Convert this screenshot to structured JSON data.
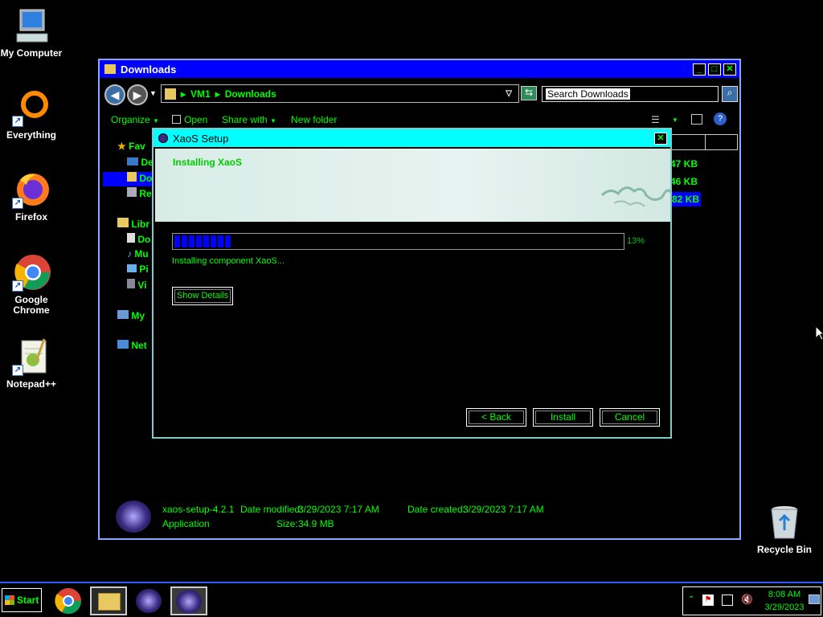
{
  "desktop": {
    "icons": [
      {
        "label": "My Computer"
      },
      {
        "label": "Everything"
      },
      {
        "label": "Firefox"
      },
      {
        "label": "Google Chrome"
      },
      {
        "label": "Notepad++"
      },
      {
        "label": "Recycle Bin"
      }
    ]
  },
  "explorer": {
    "title": "Downloads",
    "breadcrumb": [
      "VM1",
      "Downloads"
    ],
    "search_placeholder": "Search Downloads",
    "commands": [
      "Organize",
      "Open",
      "Share with",
      "New folder"
    ],
    "nav": {
      "favorites": "Fav",
      "fav_items": [
        "De",
        "Do",
        "Re"
      ],
      "libraries": "Libr",
      "lib_items": [
        "Do",
        "Mu",
        "Pi",
        "Vi"
      ],
      "computer": "My",
      "network": "Net"
    },
    "sizes": [
      "47 KB",
      "46 KB",
      "82 KB"
    ],
    "details": {
      "name": "xaos-setup-4.2.1",
      "type": "Application",
      "modified_label": "Date modified:",
      "modified_value": "3/29/2023 7:17 AM",
      "created_label": "Date created:",
      "created_value": "3/29/2023 7:17 AM",
      "size_label": "Size:",
      "size_value": "34.9 MB"
    }
  },
  "setup": {
    "title": "XaoS Setup",
    "heading": "Installing XaoS",
    "progress_percent": 13,
    "progress_label": "13%",
    "status": "Installing component XaoS...",
    "show_details": "Show Details",
    "back": "< Back",
    "install": "Install",
    "cancel": "Cancel"
  },
  "taskbar": {
    "start": "Start",
    "time": "8:08 AM",
    "date": "3/29/2023"
  },
  "colors": {
    "accent_green": "#00ff00",
    "title_blue": "#0000ff",
    "dialog_cyan": "#00ffff",
    "progress_blue": "#0000ff"
  }
}
